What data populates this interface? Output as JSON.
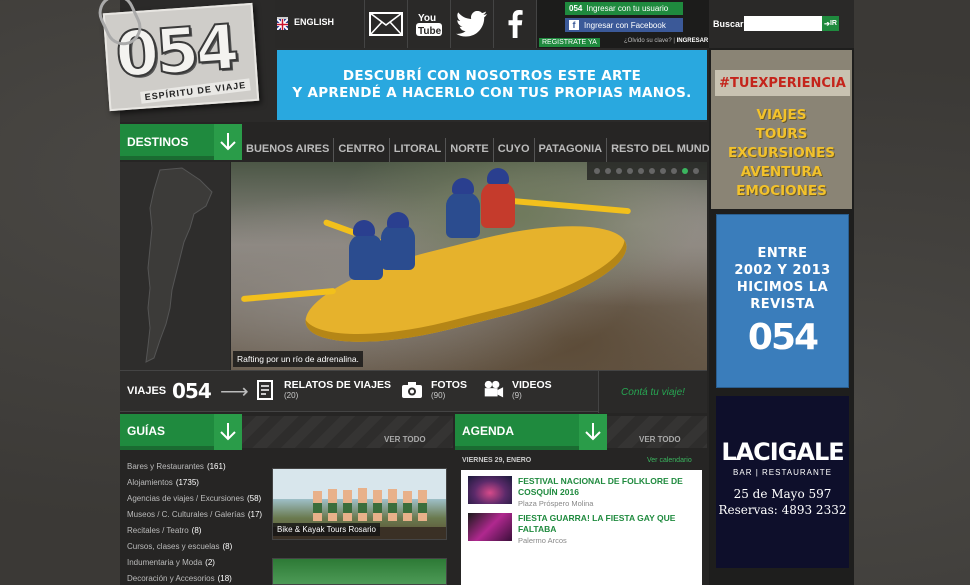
{
  "header": {
    "logo_number": "054",
    "logo_tagline": "ESPÍRITU DE VIAJE",
    "language": "ENGLISH",
    "login": {
      "user_logo": "054",
      "user_button": "Ingresar con tu usuario",
      "facebook_button": "Ingresar con Facebook",
      "register": "REGISTRATE YA",
      "forgot": "¿Olvido su clave?",
      "enter": "INGRESAR"
    },
    "search": {
      "label": "Buscar",
      "placeholder": "",
      "button": "IR"
    },
    "social_icons": [
      "mail-icon",
      "youtube-icon",
      "twitter-icon",
      "facebook-icon"
    ]
  },
  "promo_banner": {
    "line1": "DESCUBRÍ CON NOSOTROS ESTE ARTE",
    "line2": "Y APRENDÉ A HACERLO CON TUS PROPIAS MANOS."
  },
  "destinos": {
    "title": "DESTINOS",
    "regions": [
      "BUENOS AIRES",
      "CENTRO",
      "LITORAL",
      "NORTE",
      "CUYO",
      "PATAGONIA",
      "RESTO DEL MUNDO"
    ]
  },
  "hero": {
    "caption": "Rafting por un río de adrenalina.",
    "slides": 10,
    "active_slide": 9
  },
  "viajes_bar": {
    "label": "VIAJES",
    "logo": "054",
    "items": [
      {
        "title": "RELATOS DE VIAJES",
        "count": "(20)",
        "icon": "notebook-icon"
      },
      {
        "title": "FOTOS",
        "count": "(90)",
        "icon": "camera-icon"
      },
      {
        "title": "VIDEOS",
        "count": "(9)",
        "icon": "video-camera-icon"
      }
    ],
    "cta": "Contá tu viaje!"
  },
  "guias": {
    "title": "GUÍAS",
    "see_all": "VER TODO",
    "links": [
      {
        "label": "Bares y Restaurantes",
        "count": "(161)"
      },
      {
        "label": "Alojamientos",
        "count": "(1735)"
      },
      {
        "label": "Agencias de viajes / Excursiones",
        "count": "(58)"
      },
      {
        "label": "Museos / C. Culturales / Galerías",
        "count": "(17)"
      },
      {
        "label": "Recitales / Teatro",
        "count": "(8)"
      },
      {
        "label": "Cursos, clases y escuelas",
        "count": "(8)"
      },
      {
        "label": "Indumentaria y Moda",
        "count": "(2)"
      },
      {
        "label": "Decoración y Accesorios",
        "count": "(18)"
      }
    ],
    "featured_caption": "Bike & Kayak Tours Rosario"
  },
  "agenda": {
    "title": "AGENDA",
    "see_all": "VER TODO",
    "date": "VIERNES 29, ENERO",
    "calendar_link": "Ver calendario",
    "events": [
      {
        "title": "FESTIVAL NACIONAL DE FOLKLORE DE COSQUÍN 2016",
        "place": "Plaza Próspero Molina"
      },
      {
        "title": "FIESTA GUARRA! LA FIESTA GAY QUE FALTABA",
        "place": "Palermo Arcos"
      }
    ]
  },
  "sidebar": {
    "tuexperiencia": {
      "title": "#TUEXPERIENCIA",
      "items": [
        "VIAJES",
        "TOURS",
        "EXCURSIONES",
        "AVENTURA",
        "EMOCIONES"
      ]
    },
    "revista": {
      "lines": [
        "ENTRE",
        "2002 Y 2013",
        "HICIMOS LA",
        "REVISTA"
      ],
      "logo": "054"
    },
    "lacigale": {
      "name": "LACIGALE",
      "subtitle": "BAR | RESTAURANTE",
      "address": "25 de Mayo 597",
      "phone": "Reservas: 4893 2332"
    }
  },
  "colors": {
    "green": "#1f8a3e",
    "blue_banner": "#29a8df",
    "dark_bg": "#262524",
    "facebook": "#3b5998",
    "revista_blue": "#3a7dbb",
    "cigale_navy": "#0e0f2b",
    "tuexp_yellow": "#f3c22b"
  }
}
